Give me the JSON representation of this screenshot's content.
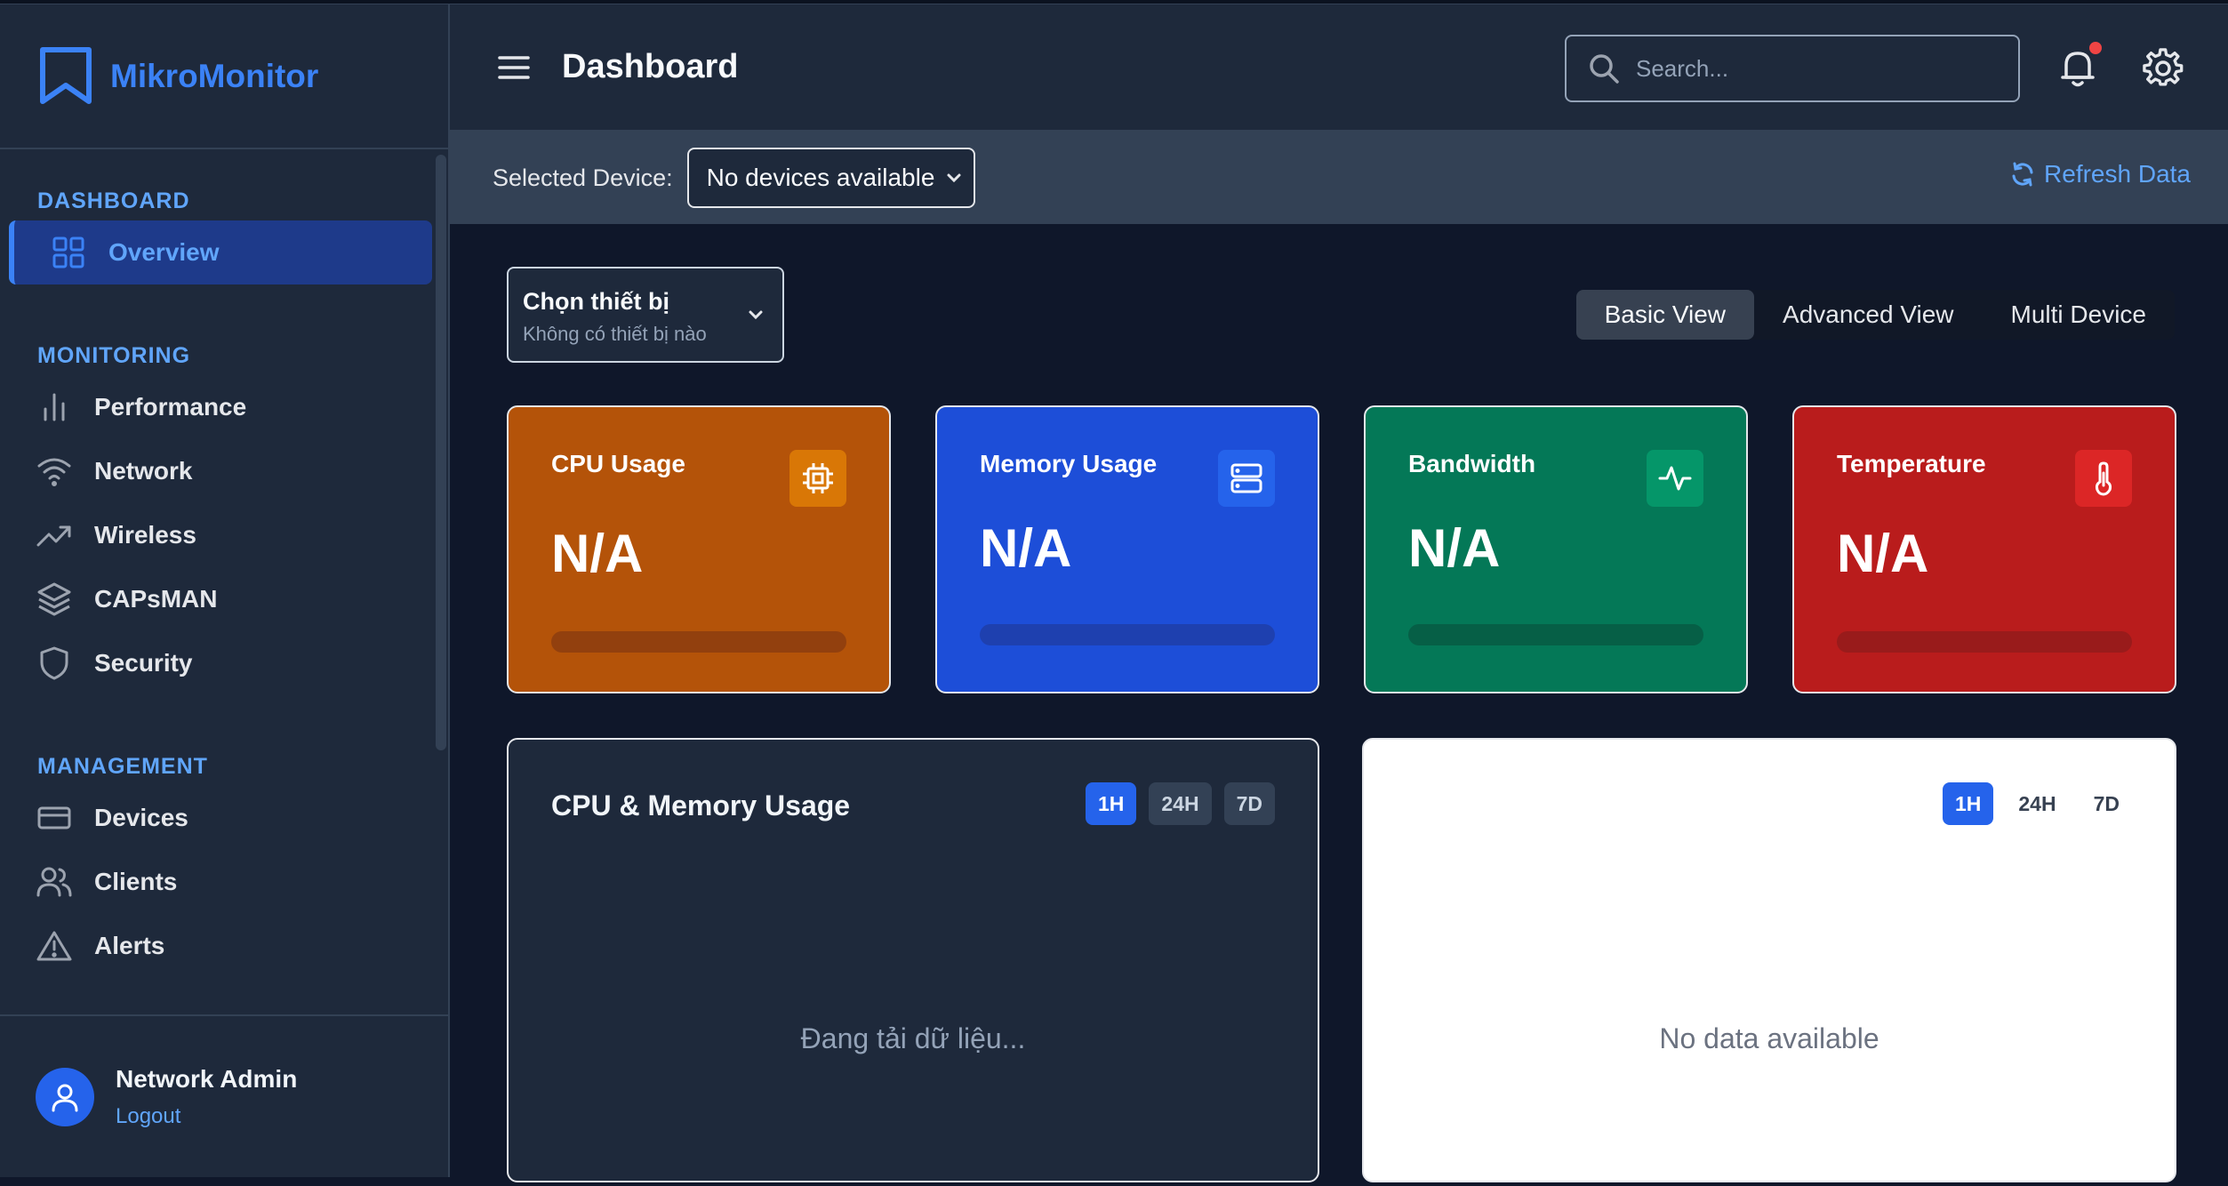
{
  "brand": {
    "name": "MikroMonitor"
  },
  "sidebar": {
    "sections": [
      {
        "title": "DASHBOARD"
      },
      {
        "title": "MONITORING"
      },
      {
        "title": "MANAGEMENT"
      }
    ],
    "items": {
      "overview": "Overview",
      "performance": "Performance",
      "network": "Network",
      "wireless": "Wireless",
      "capsman": "CAPsMAN",
      "security": "Security",
      "devices": "Devices",
      "clients": "Clients",
      "alerts": "Alerts"
    },
    "user": {
      "name": "Network Admin",
      "logout": "Logout"
    }
  },
  "header": {
    "title": "Dashboard",
    "search_placeholder": "Search...",
    "has_notification": true
  },
  "device_bar": {
    "label": "Selected Device:",
    "selected": "No devices available",
    "refresh": "Refresh Data"
  },
  "device_picker": {
    "title": "Chọn thiết bị",
    "subtitle": "Không có thiết bị nào"
  },
  "view_tabs": [
    "Basic View",
    "Advanced View",
    "Multi Device"
  ],
  "active_view": "Basic View",
  "stats": [
    {
      "title": "CPU Usage",
      "value": "N/A",
      "icon": "cpu-icon",
      "color": "#b45309",
      "badge": "#d97706",
      "bar": "#92400e"
    },
    {
      "title": "Memory Usage",
      "value": "N/A",
      "icon": "server-icon",
      "color": "#1d4ed8",
      "badge": "#2563eb",
      "bar": "#1e40af"
    },
    {
      "title": "Bandwidth",
      "value": "N/A",
      "icon": "activity-icon",
      "color": "#047857",
      "badge": "#059669",
      "bar": "#065f46"
    },
    {
      "title": "Temperature",
      "value": "N/A",
      "icon": "thermometer-icon",
      "color": "#b91c1c",
      "badge": "#dc2626",
      "bar": "#991b1b"
    }
  ],
  "charts": {
    "cpu_memory": {
      "title": "CPU & Memory Usage",
      "ranges": [
        "1H",
        "24H",
        "7D"
      ],
      "active_range": "1H",
      "message": "Đang tải dữ liệu..."
    },
    "secondary": {
      "ranges": [
        "1H",
        "24H",
        "7D"
      ],
      "active_range": "1H",
      "message": "No data available"
    }
  },
  "colors": {
    "accent": "#3b82f6",
    "sidebar": "#1e293b",
    "main": "#0f172a"
  }
}
